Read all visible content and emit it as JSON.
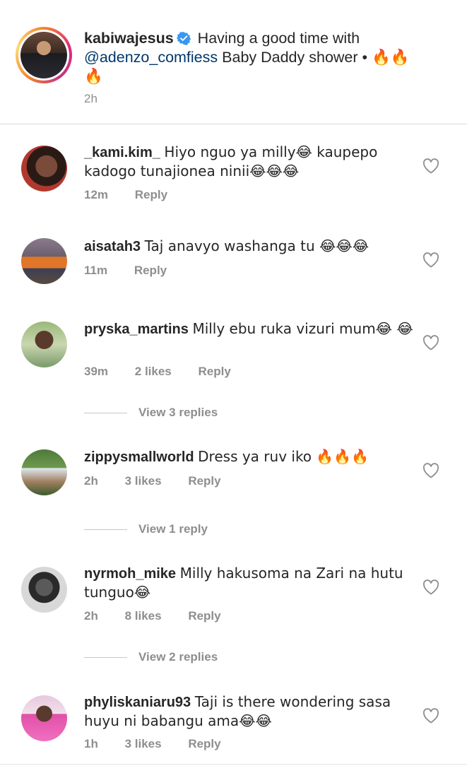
{
  "caption": {
    "username": "kabiwajesus",
    "text_before": "Having a good time with",
    "mention": "@adenzo_comfiess",
    "text_after": "Baby Daddy shower •",
    "emoji_line": "🔥🔥",
    "emoji_line2": "🔥",
    "time": "2h",
    "verified_icon": "verified-badge-icon"
  },
  "comments": [
    {
      "username": "_kami.kim_",
      "text": "Hiyo nguo ya milly😂 kaupepo kadogo tunajionea ninii😂😂😂",
      "time": "12m",
      "likes": "",
      "reply_label": "Reply"
    },
    {
      "username": "aisatah3",
      "text": "Taj anavyo washanga tu 😂😂😂",
      "time": "11m",
      "likes": "",
      "reply_label": "Reply"
    },
    {
      "username": "pryska_martins",
      "text": "Milly ebu ruka vizuri mum😂 😂",
      "time": "39m",
      "likes": "2 likes",
      "reply_label": "Reply",
      "view_replies": "View 3 replies"
    },
    {
      "username": "zippysmallworld",
      "text": "Dress ya ruv iko 🔥🔥🔥",
      "time": "2h",
      "likes": "3 likes",
      "reply_label": "Reply",
      "view_replies": "View 1 reply"
    },
    {
      "username": "nyrmoh_mike",
      "text": "Milly hakusoma na Zari na hutu tunguo😂",
      "time": "2h",
      "likes": "8 likes",
      "reply_label": "Reply",
      "view_replies": "View 2 replies"
    },
    {
      "username": "phyliskaniaru93",
      "text": "Taji is there wondering sasa huyu ni babangu ama😂😂",
      "time": "1h",
      "likes": "3 likes",
      "reply_label": "Reply"
    }
  ],
  "icons": {
    "like": "heart-outline-icon"
  },
  "colors": {
    "text": "#262626",
    "secondary": "#8e8e8e",
    "mention": "#00376b",
    "verified": "#3897f0"
  }
}
